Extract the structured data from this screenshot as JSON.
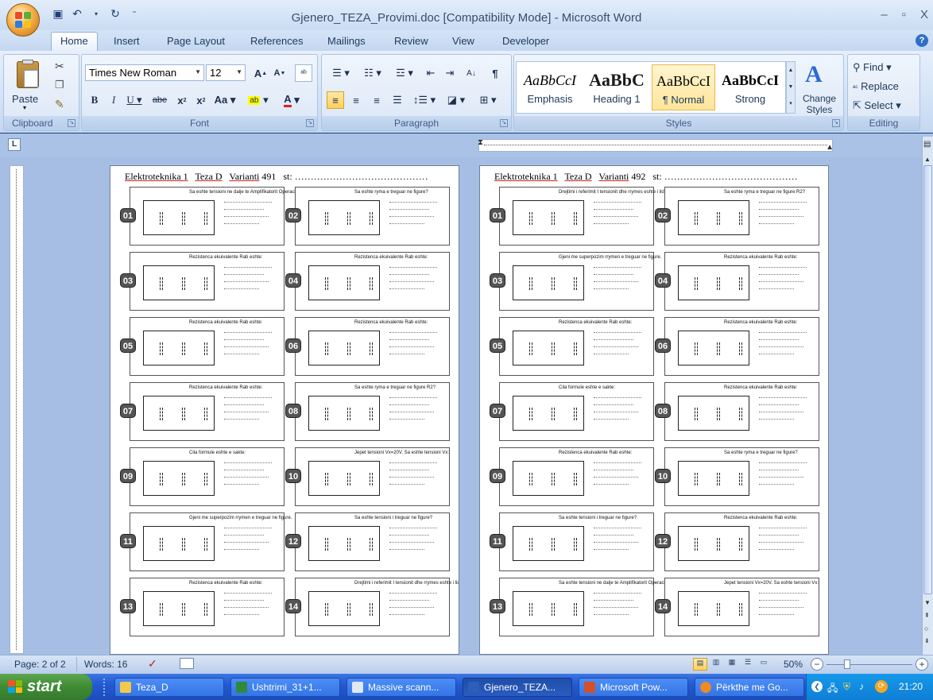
{
  "window": {
    "title": "Gjenero_TEZA_Provimi.doc [Compatibility Mode] - Microsoft Word",
    "minimize": "–",
    "restore": "▫",
    "close": "X"
  },
  "tabs": [
    "Home",
    "Insert",
    "Page Layout",
    "References",
    "Mailings",
    "Review",
    "View",
    "Developer"
  ],
  "ribbon": {
    "clipboard": {
      "label": "Clipboard",
      "paste": "Paste"
    },
    "font": {
      "label": "Font",
      "family": "Times New Roman",
      "size": "12"
    },
    "paragraph": {
      "label": "Paragraph"
    },
    "styles": {
      "label": "Styles",
      "items": [
        {
          "sample": "AaBbCcI",
          "name": "Emphasis"
        },
        {
          "sample": "AaBbC",
          "name": "Heading 1"
        },
        {
          "sample": "AaBbCcI",
          "name": "¶ Normal"
        },
        {
          "sample": "AaBbCcI",
          "name": "Strong"
        }
      ],
      "change": "Change Styles"
    },
    "editing": {
      "label": "Editing",
      "find": "Find",
      "replace": "Replace",
      "select": "Select"
    }
  },
  "pages": [
    {
      "header_a": "Elektroteknika 1",
      "header_b": "Teza D",
      "header_c": "Varianti",
      "header_num": "491",
      "header_d": "st: ……………………………………"
    },
    {
      "header_a": "Elektroteknika 1",
      "header_b": "Teza D",
      "header_c": "Varianti",
      "header_num": "492",
      "header_d": "st: ……………………………………"
    }
  ],
  "questions_left": [
    {
      "n": "01",
      "title": "Sa eshte tensioni ne dalje te Amplifikatorit Operacional?"
    },
    {
      "n": "02",
      "title": "Sa eshte ryma e treguar ne figure?"
    },
    {
      "n": "03",
      "title": "Rezistenca ekuivalente Rab eshte:"
    },
    {
      "n": "04",
      "title": "Rezistenca ekuivalente Rab eshte:"
    },
    {
      "n": "05",
      "title": "Rezistenca ekuivalente Rab eshte:"
    },
    {
      "n": "06",
      "title": "Rezistenca ekuivalente Rab eshte:"
    },
    {
      "n": "07",
      "title": "Rezistenca ekuivalente Rab eshte:"
    },
    {
      "n": "08",
      "title": "Sa eshte ryma e treguar ne figure R2?"
    },
    {
      "n": "09",
      "title": "Cila formule eshte e sakte:"
    },
    {
      "n": "10",
      "title": "Jepet tensioni Vx=20V. Sa eshte tensioni Vx:"
    },
    {
      "n": "11",
      "title": "Gjeni me superpozim rrymen e treguar ne figure."
    },
    {
      "n": "12",
      "title": "Sa eshte tensioni i treguar ne figure?"
    },
    {
      "n": "13",
      "title": "Rezistenca ekuivalente Rab eshte:"
    },
    {
      "n": "14",
      "title": "Drejtimi i referimit I tensionit dhe rrymes eshte i lidhur ne figurat:"
    }
  ],
  "questions_right": [
    {
      "n": "01",
      "title": "Drejtimi i referimit I tensionit dhe rrymes eshte i lidhur ne figurat:"
    },
    {
      "n": "02",
      "title": "Sa eshte ryma e treguar ne figure R2?"
    },
    {
      "n": "03",
      "title": "Gjeni me superpozim rrymen e treguar ne figure."
    },
    {
      "n": "04",
      "title": "Rezistenca ekuivalente Rab eshte:"
    },
    {
      "n": "05",
      "title": "Rezistenca ekuivalente Rab eshte:"
    },
    {
      "n": "06",
      "title": "Rezistenca ekuivalente Rab eshte:"
    },
    {
      "n": "07",
      "title": "Cila formule eshte e sakte:"
    },
    {
      "n": "08",
      "title": "Rezistenca ekuivalente Rab eshte:"
    },
    {
      "n": "09",
      "title": "Rezistenca ekuivalente Rab eshte:"
    },
    {
      "n": "10",
      "title": "Sa eshte ryma e treguar ne figure?"
    },
    {
      "n": "11",
      "title": "Sa eshte tensioni i treguar ne figure?"
    },
    {
      "n": "12",
      "title": "Rezistenca ekuivalente Rab eshte:"
    },
    {
      "n": "13",
      "title": "Sa eshte tensioni ne dalje te Amplifikatorit Operacional?"
    },
    {
      "n": "14",
      "title": "Jepet tensioni Vx=20V. Sa eshte tensioni Vx:"
    }
  ],
  "status": {
    "page": "Page: 2 of 2",
    "words": "Words: 16",
    "zoom": "50%"
  },
  "taskbar": {
    "start": "start",
    "items": [
      "Teza_D",
      "Ushtrimi_31+1...",
      "Massive scann...",
      "Gjenero_TEZA...",
      "Microsoft Pow...",
      "Përkthe me Go..."
    ],
    "clock": "21:20"
  }
}
